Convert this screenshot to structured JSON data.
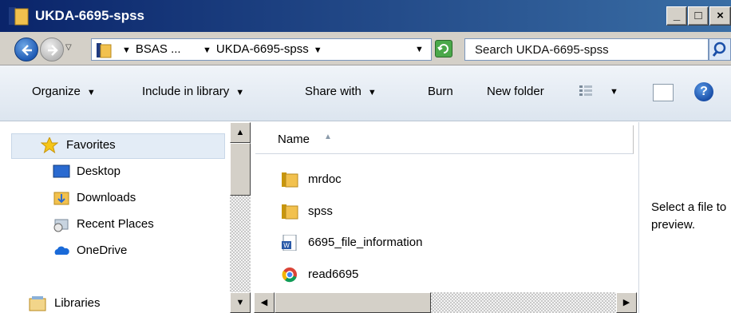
{
  "window": {
    "title": "UKDA-6695-spss",
    "minimize_label": "_",
    "maximize_label": "□",
    "close_label": "×"
  },
  "address_bar": {
    "breadcrumbs": [
      "BSAS ...",
      "UKDA-6695-spss"
    ],
    "search_placeholder": "Search UKDA-6695-spss"
  },
  "command_bar": {
    "organize": "Organize",
    "include_in_library": "Include in library",
    "share_with": "Share with",
    "burn": "Burn",
    "new_folder": "New folder"
  },
  "nav_pane": {
    "favorites": "Favorites",
    "items": [
      "Desktop",
      "Downloads",
      "Recent Places",
      "OneDrive"
    ],
    "libraries": "Libraries"
  },
  "file_list": {
    "column_name": "Name",
    "files": [
      {
        "name": "mrdoc",
        "icon": "folder-icon"
      },
      {
        "name": "spss",
        "icon": "folder-icon"
      },
      {
        "name": "6695_file_information",
        "icon": "word-document-icon"
      },
      {
        "name": "read6695",
        "icon": "chrome-icon"
      }
    ]
  },
  "preview_pane": {
    "message": "Select a file to preview."
  },
  "colors": {
    "titlebar_start": "#0a246a",
    "titlebar_end": "#3a6ea5",
    "chrome": "#d4d0c8",
    "selection": "#e3ecf6"
  }
}
